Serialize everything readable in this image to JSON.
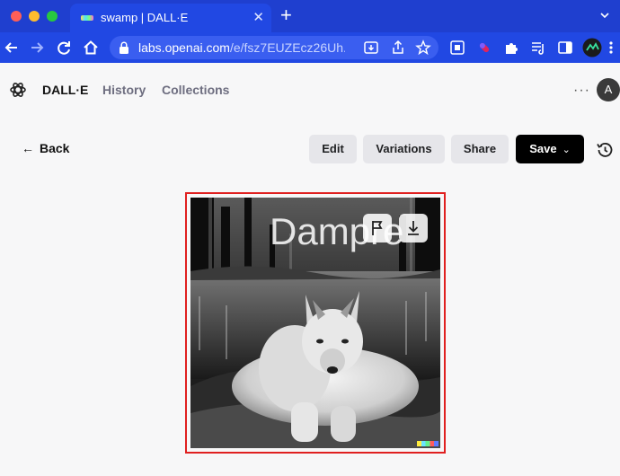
{
  "browser": {
    "tab_title": "swamp | DALL·E",
    "tab_close": "✕",
    "new_tab": "+",
    "url_host": "labs.openai.com",
    "url_path": "/e/fsz7EUZEcz26Uh..."
  },
  "header": {
    "brand": "DALL·E",
    "nav": [
      "History",
      "Collections"
    ],
    "more": "···",
    "avatar_initial": "A"
  },
  "toolbar": {
    "back": "Back",
    "edit": "Edit",
    "variations": "Variations",
    "share": "Share",
    "save": "Save"
  },
  "image": {
    "caption_text": "Dampre"
  },
  "colors": {
    "chrome": "#2148e3",
    "highlight_border": "#e02020",
    "save_button": "#000000"
  }
}
